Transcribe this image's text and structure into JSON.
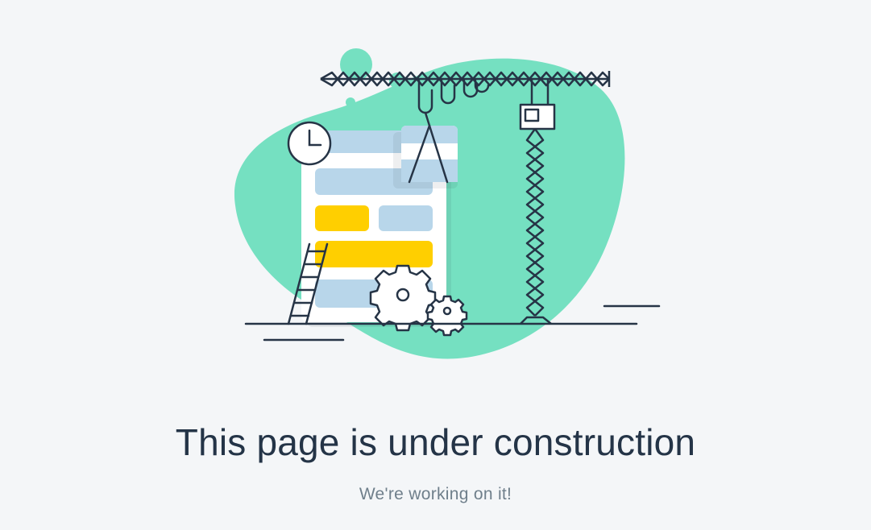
{
  "page": {
    "title": "This page is under construction",
    "subtitle": "We're working on it!"
  },
  "illustration": {
    "subject": "under-construction",
    "colors": {
      "background": "#f4f6f8",
      "blob": "#75e0c1",
      "outline": "#263446",
      "card_fill": "#ffffff",
      "card_header": "#b8d6ea",
      "block_blue": "#b8d6ea",
      "block_yellow": "#ffcf00"
    }
  }
}
